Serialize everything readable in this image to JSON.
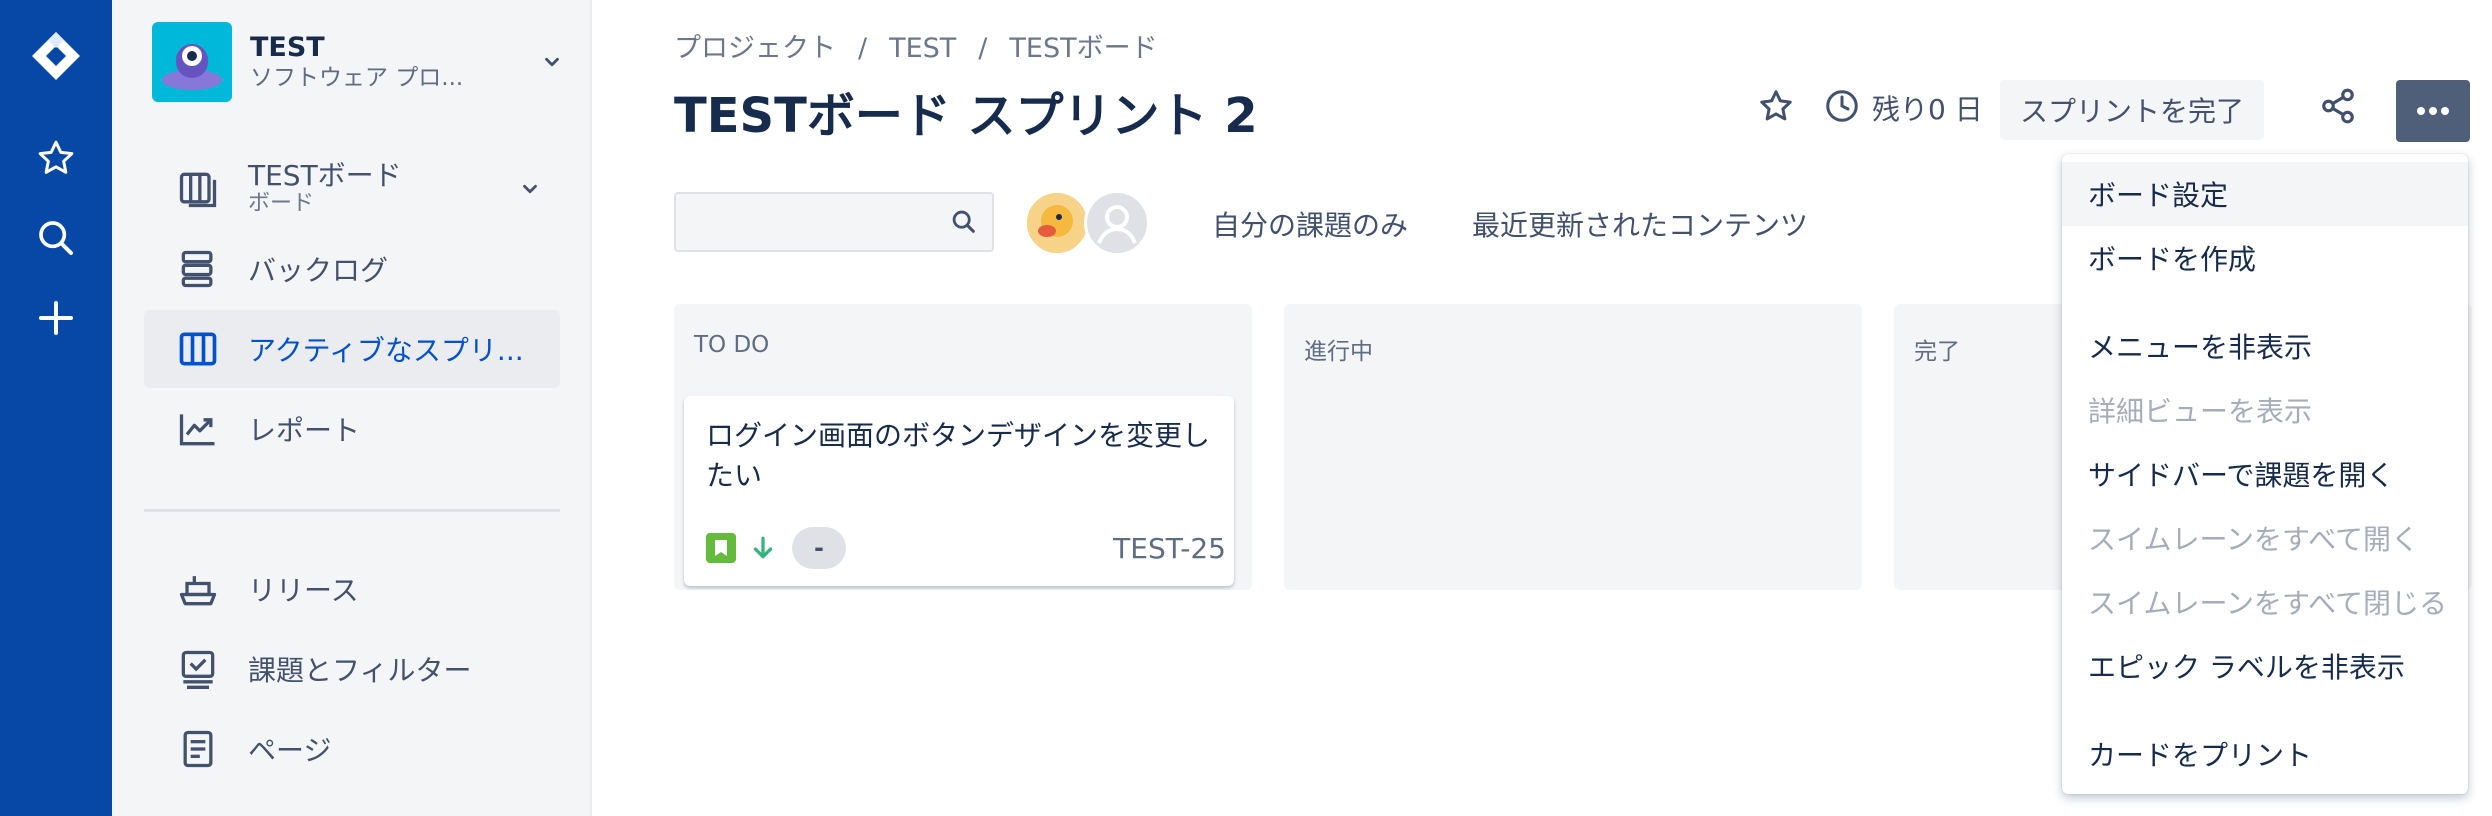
{
  "project": {
    "name": "TEST",
    "type": "ソフトウェア プロ..."
  },
  "sidebar": {
    "board": {
      "label": "TESTボード",
      "sublabel": "ボード"
    },
    "items": [
      {
        "label": "バックログ"
      },
      {
        "label": "アクティブなスプリ..."
      },
      {
        "label": "レポート"
      },
      {
        "label": "リリース"
      },
      {
        "label": "課題とフィルター"
      },
      {
        "label": "ページ"
      }
    ]
  },
  "breadcrumb": {
    "items": [
      "プロジェクト",
      "TEST",
      "TESTボード"
    ],
    "separator": "/"
  },
  "page_title": "TESTボード スプリント 2",
  "header": {
    "remaining": "残り0 日",
    "complete_label": "スプリントを完了"
  },
  "filters": {
    "search_placeholder": "",
    "quick_filters": [
      "自分の課題のみ",
      "最近更新されたコンテンツ"
    ]
  },
  "columns": [
    {
      "title": "TO DO",
      "cards": [
        {
          "summary": "ログイン画面のボタンデザインを変更したい",
          "estimate": "-",
          "key": "TEST-25"
        }
      ]
    },
    {
      "title": "進行中",
      "cards": []
    },
    {
      "title": "完了",
      "cards": []
    }
  ],
  "menu": {
    "items": [
      {
        "label": "ボード設定",
        "disabled": false
      },
      {
        "label": "ボードを作成",
        "disabled": false
      },
      {
        "label": "メニューを非表示",
        "disabled": false
      },
      {
        "label": "詳細ビューを表示",
        "disabled": true
      },
      {
        "label": "サイドバーで課題を開く",
        "disabled": false
      },
      {
        "label": "スイムレーンをすべて開く",
        "disabled": true
      },
      {
        "label": "スイムレーンをすべて閉じる",
        "disabled": true
      },
      {
        "label": "エピック ラベルを非表示",
        "disabled": false
      },
      {
        "label": "カードをプリント",
        "disabled": false
      }
    ]
  },
  "colors": {
    "global_nav": "#0747A6",
    "sidebar_bg": "#F4F5F7",
    "active_link": "#0052CC",
    "story_icon": "#63BA3C",
    "priority_low": "#36B37E",
    "more_button": "#505F79"
  },
  "icons": {
    "global_nav": [
      "jira-logo-icon",
      "star-icon",
      "search-icon",
      "plus-icon"
    ],
    "sidebar": [
      "board-icon",
      "backlog-icon",
      "active-sprint-icon",
      "reports-icon",
      "releases-icon",
      "issues-filters-icon",
      "pages-icon"
    ],
    "header": [
      "star-icon",
      "clock-icon",
      "share-icon",
      "more-icon"
    ]
  }
}
